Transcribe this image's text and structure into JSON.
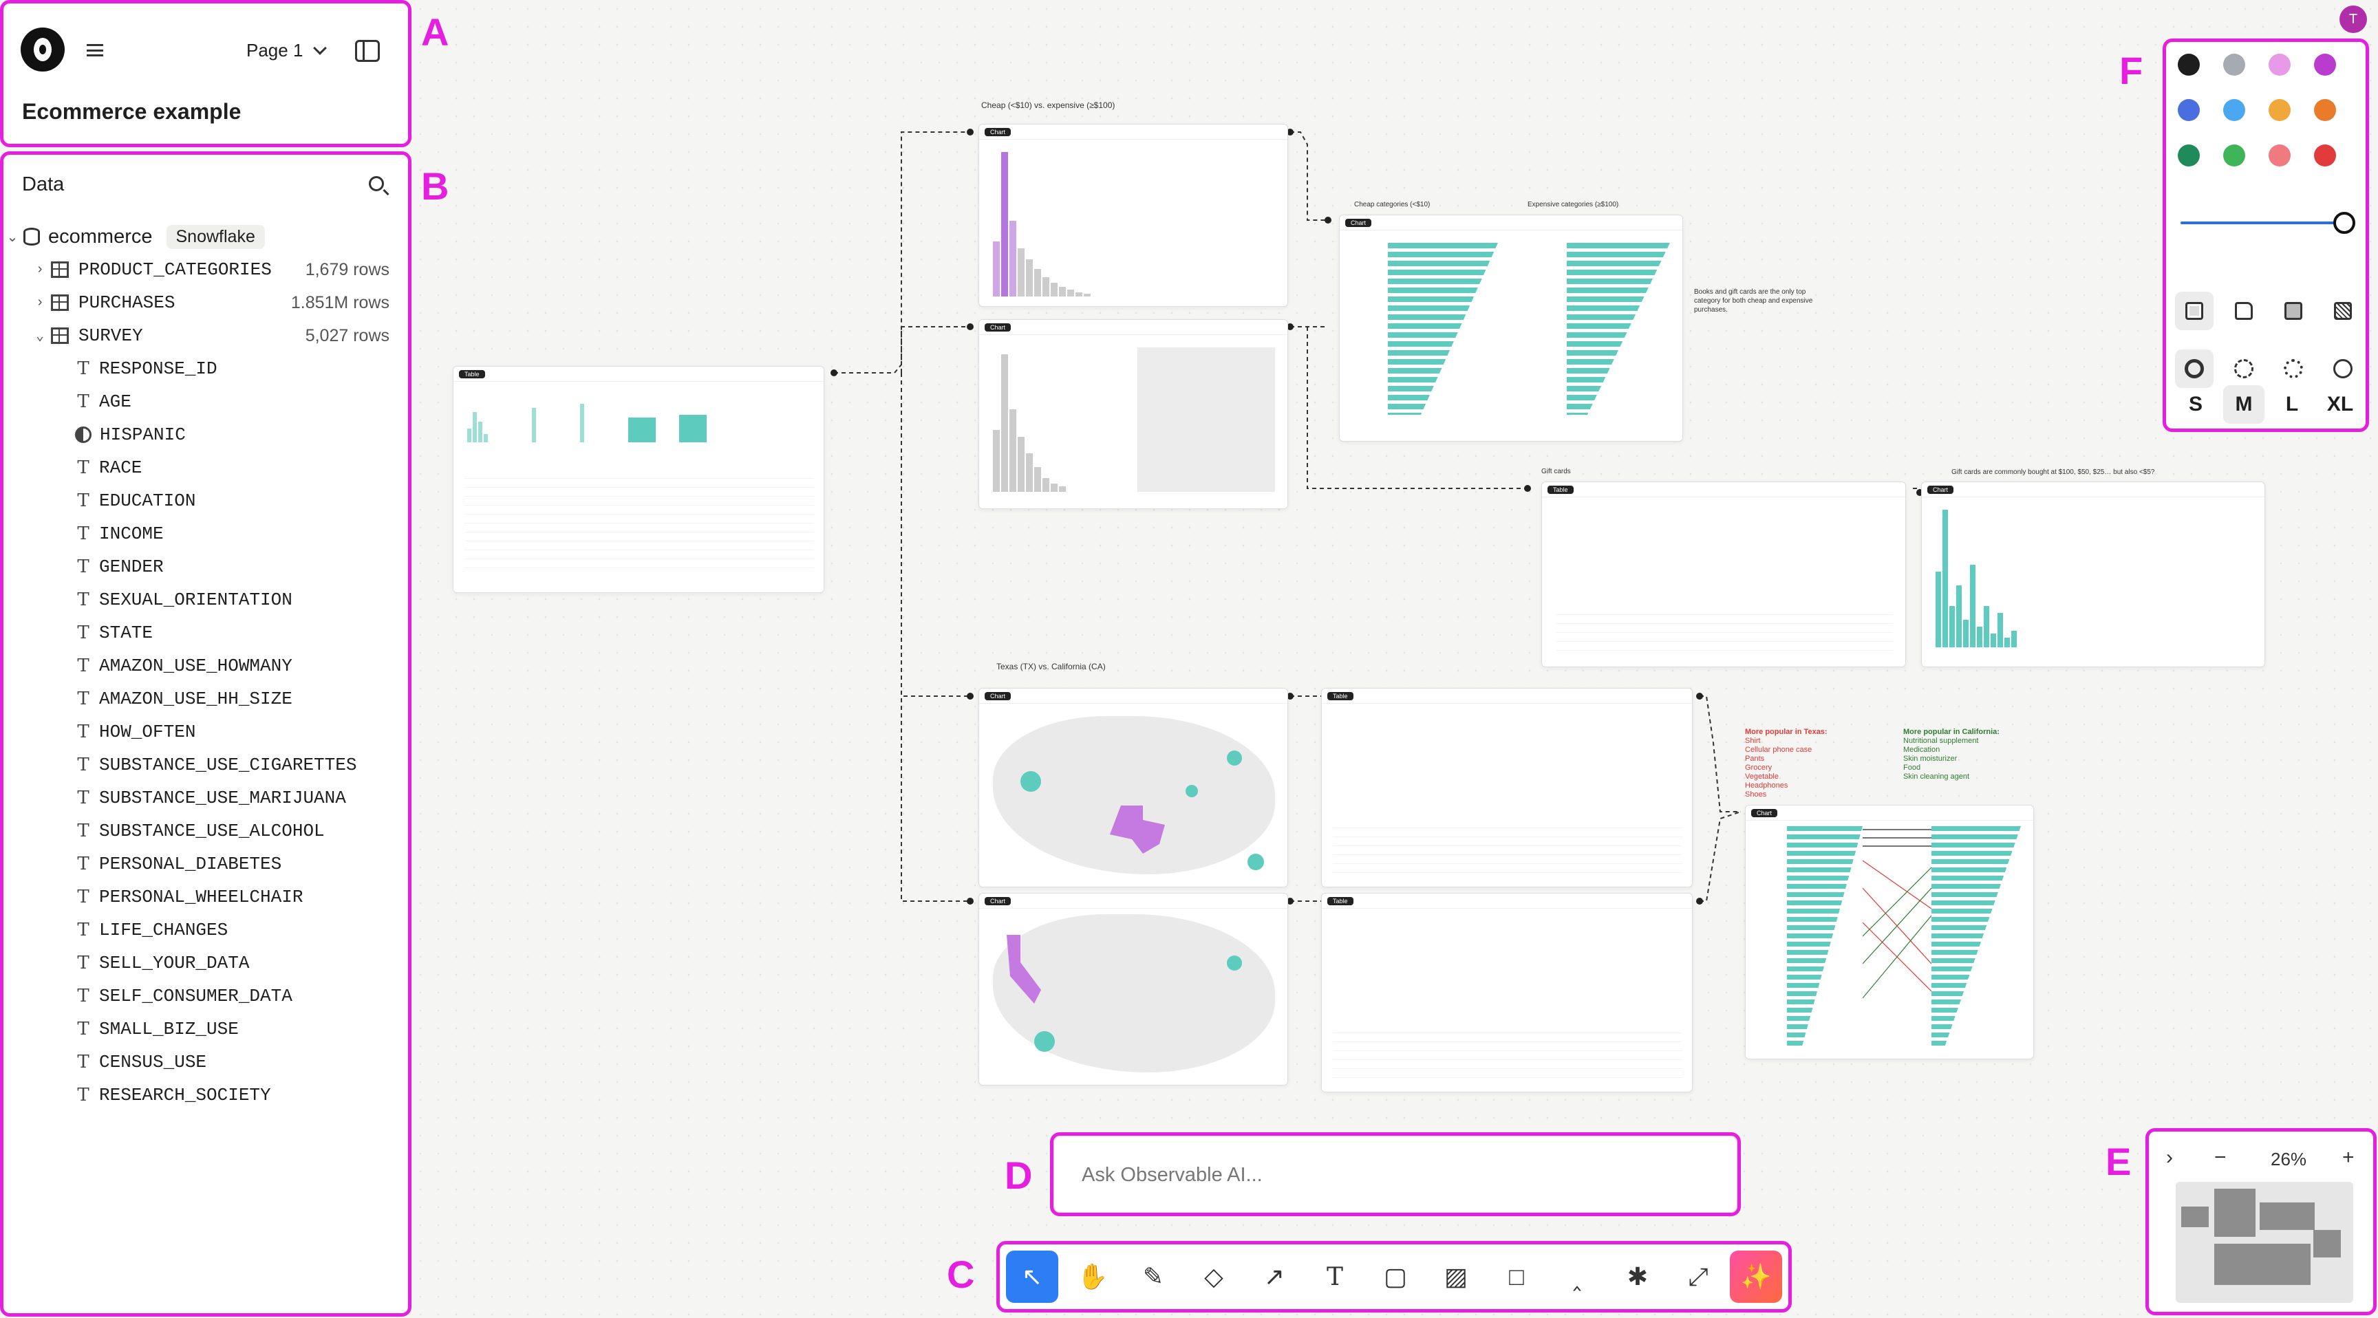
{
  "header": {
    "page_label": "Page 1",
    "notebook_title": "Ecommerce example"
  },
  "data_panel": {
    "title": "Data",
    "database": {
      "name": "ecommerce",
      "badge": "Snowflake"
    },
    "tables": [
      {
        "name": "PRODUCT_CATEGORIES",
        "rows": "1,679 rows"
      },
      {
        "name": "PURCHASES",
        "rows": "1.851M rows"
      },
      {
        "name": "SURVEY",
        "rows": "5,027 rows"
      }
    ],
    "columns": [
      "RESPONSE_ID",
      "AGE",
      "HISPANIC",
      "RACE",
      "EDUCATION",
      "INCOME",
      "GENDER",
      "SEXUAL_ORIENTATION",
      "STATE",
      "AMAZON_USE_HOWMANY",
      "AMAZON_USE_HH_SIZE",
      "HOW_OFTEN",
      "SUBSTANCE_USE_CIGARETTES",
      "SUBSTANCE_USE_MARIJUANA",
      "SUBSTANCE_USE_ALCOHOL",
      "PERSONAL_DIABETES",
      "PERSONAL_WHEELCHAIR",
      "LIFE_CHANGES",
      "SELL_YOUR_DATA",
      "SELF_CONSUMER_DATA",
      "SMALL_BIZ_USE",
      "CENSUS_USE",
      "RESEARCH_SOCIETY"
    ]
  },
  "canvas": {
    "cheap_vs_expensive_title": "Cheap (<$10) vs. expensive (≥$100)",
    "cheap_categories_title": "Cheap categories (<$10)",
    "expensive_categories_title": "Expensive categories (≥$100)",
    "books_note": "Books and gift cards are the only top category for both cheap and expensive purchases.",
    "gift_cards_title": "Gift cards",
    "gift_cards_note": "Gift cards are commonly bought at $100, $50, $25… but also <$5?",
    "tx_ca_title": "Texas (TX) vs. California (CA)",
    "texas_heading": "More popular in Texas:",
    "texas_items": [
      "Shirt",
      "Cellular phone case",
      "Pants",
      "Grocery",
      "Vegetable",
      "Headphones",
      "Shoes"
    ],
    "california_heading": "More popular in California:",
    "california_items": [
      "Nutritional supplement",
      "Medication",
      "Skin moisturizer",
      "Food",
      "Skin cleaning agent"
    ],
    "chip_chart": "Chart",
    "chip_table": "Table"
  },
  "palette": {
    "colors": [
      "#1d1d1d",
      "#a6aab3",
      "#e79ae7",
      "#b93ccf",
      "#4a6ee0",
      "#4aa8f0",
      "#f0a83a",
      "#ea7b2a",
      "#1f8a5a",
      "#3fb55a",
      "#f07a80",
      "#e23b3b"
    ],
    "sizes": [
      "S",
      "M",
      "L",
      "XL"
    ],
    "selected_size": "M",
    "stroke_width": 1.0
  },
  "ai": {
    "placeholder": "Ask Observable AI..."
  },
  "toolbar": {
    "tools": [
      "select-icon",
      "hand-icon",
      "pencil-icon",
      "eraser-icon",
      "arrow-icon",
      "text-icon",
      "sticky-note-icon",
      "image-icon",
      "rectangle-icon",
      "caret-up-icon",
      "asterisk-icon",
      "connector-icon",
      "ai-sparkle-icon"
    ],
    "active": "select-icon"
  },
  "minimap": {
    "zoom": "26%"
  },
  "callouts": [
    "A",
    "B",
    "C",
    "D",
    "E",
    "F"
  ],
  "user": {
    "initial": "T"
  }
}
